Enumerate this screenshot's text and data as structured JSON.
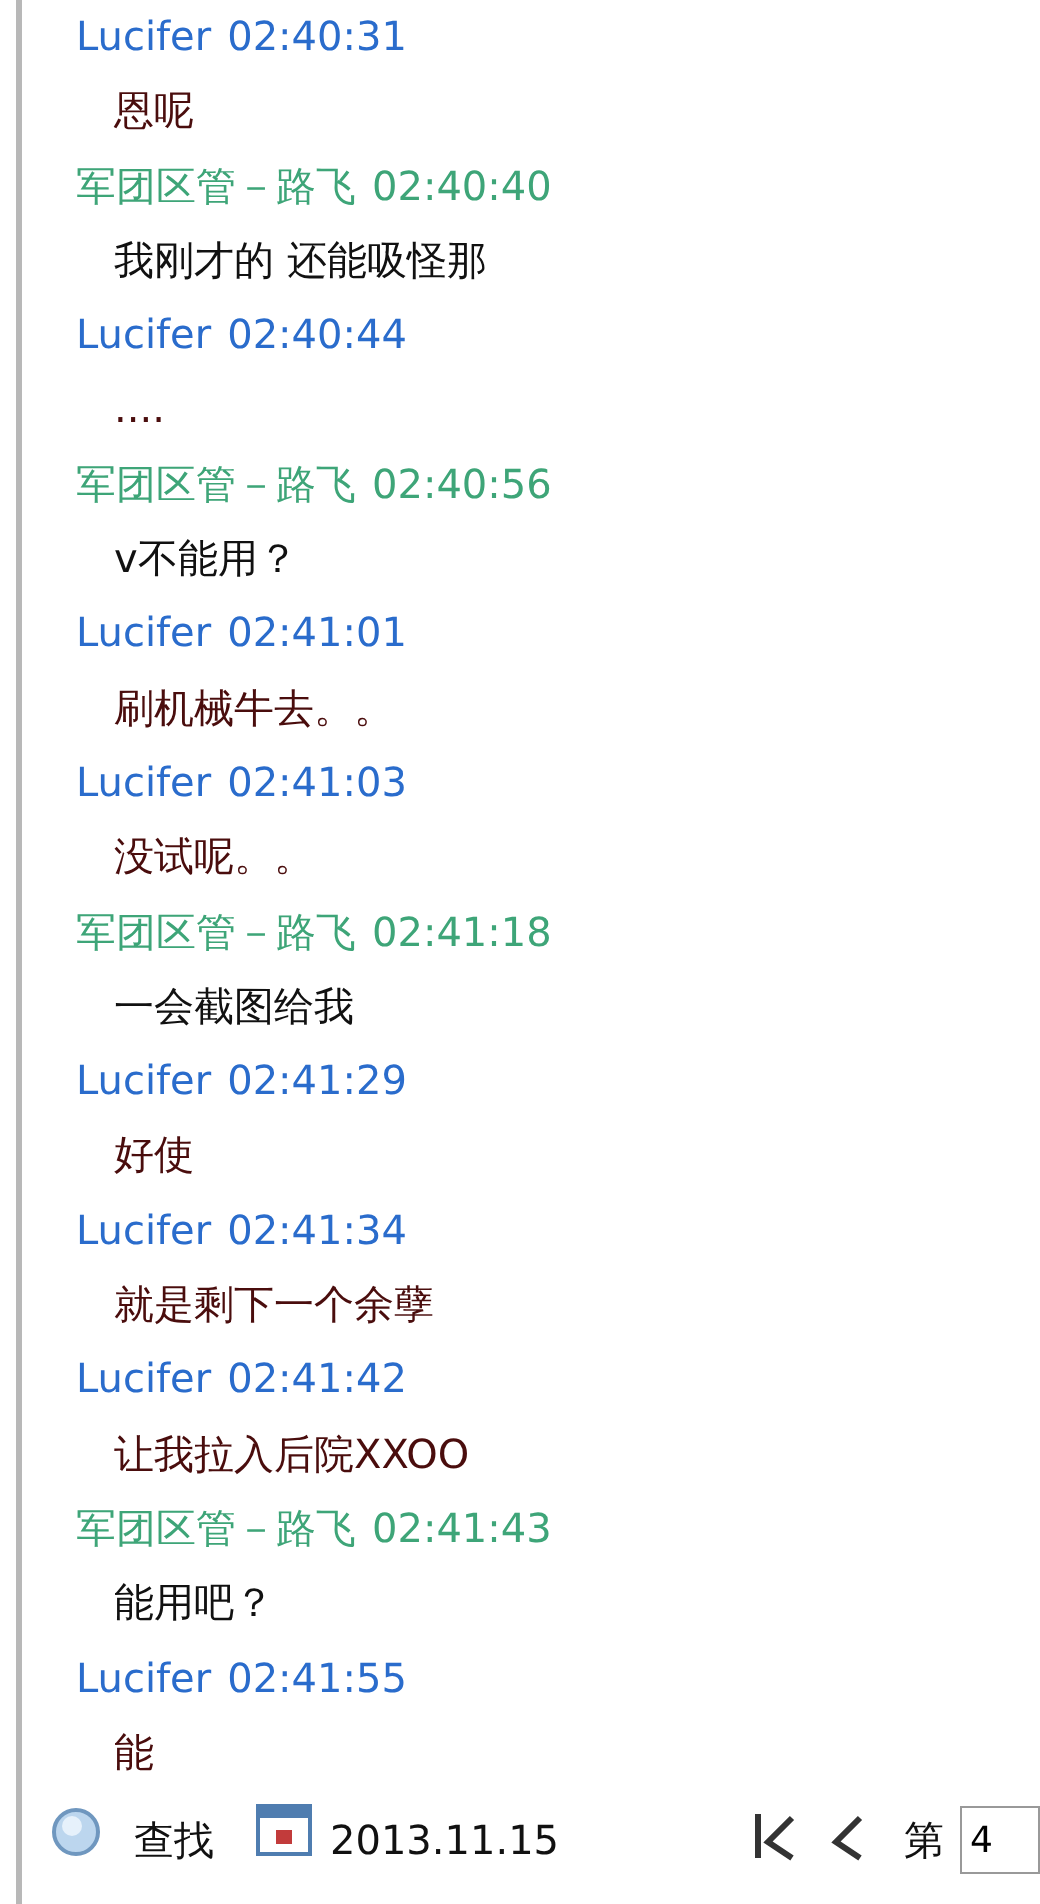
{
  "messages": [
    {
      "kind": "self",
      "sender": "Lucifer",
      "time": "02:40:31",
      "text": "恩呢"
    },
    {
      "kind": "other",
      "sender": "军团区管－路飞",
      "time": "02:40:40",
      "text": "我刚才的 还能吸怪那"
    },
    {
      "kind": "self",
      "sender": "Lucifer",
      "time": "02:40:44",
      "text": "...."
    },
    {
      "kind": "other",
      "sender": "军团区管－路飞",
      "time": "02:40:56",
      "text": "v不能用？"
    },
    {
      "kind": "self",
      "sender": "Lucifer",
      "time": "02:41:01",
      "text": "刷机械牛去。。"
    },
    {
      "kind": "self",
      "sender": "Lucifer",
      "time": "02:41:03",
      "text": "没试呢。。"
    },
    {
      "kind": "other",
      "sender": "军团区管－路飞",
      "time": "02:41:18",
      "text": "一会截图给我"
    },
    {
      "kind": "self",
      "sender": "Lucifer",
      "time": "02:41:29",
      "text": "好使"
    },
    {
      "kind": "self",
      "sender": "Lucifer",
      "time": "02:41:34",
      "text": "就是剩下一个余孽"
    },
    {
      "kind": "self",
      "sender": "Lucifer",
      "time": "02:41:42",
      "text": "让我拉入后院XXOO"
    },
    {
      "kind": "other",
      "sender": "军团区管－路飞",
      "time": "02:41:43",
      "text": "能用吧？"
    },
    {
      "kind": "self",
      "sender": "Lucifer",
      "time": "02:41:55",
      "text": "能"
    }
  ],
  "toolbar": {
    "find_label": "查找",
    "date": "2013.11.15",
    "page_label": "第",
    "page_value": "4"
  }
}
